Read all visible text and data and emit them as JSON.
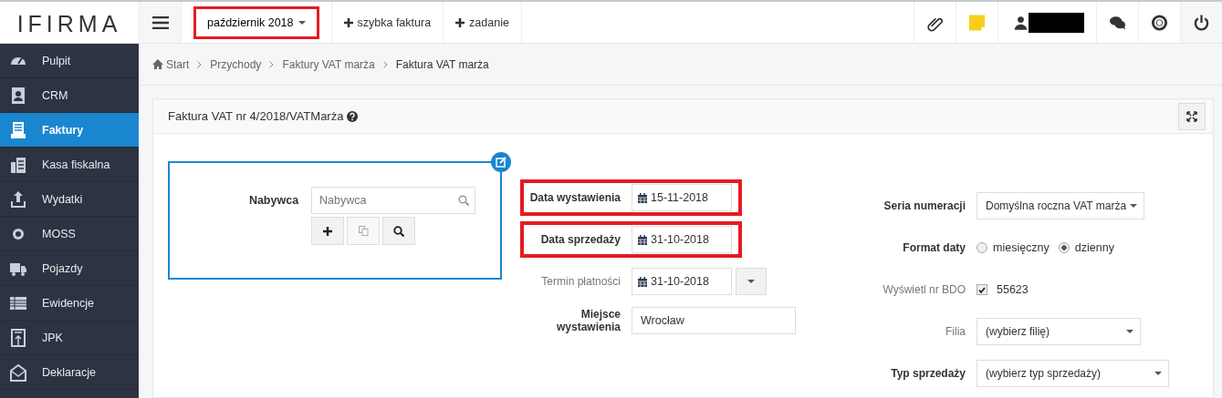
{
  "logo": {
    "text": "IFIRMA"
  },
  "topbar": {
    "period": {
      "label": "październik 2018",
      "highlighted": true
    },
    "actions": [
      {
        "label": "szybka faktura"
      },
      {
        "label": "zadanie"
      }
    ],
    "tools": [
      {
        "kind": "clip"
      },
      {
        "kind": "note"
      },
      {
        "kind": "user"
      },
      {
        "kind": "chat"
      },
      {
        "kind": "help"
      },
      {
        "kind": "power"
      }
    ]
  },
  "sidebar": {
    "items": [
      {
        "label": "Pulpit",
        "kind": "gauge",
        "selected": false
      },
      {
        "label": "CRM",
        "kind": "contact",
        "selected": false
      },
      {
        "label": "Faktury",
        "kind": "invoice",
        "selected": true
      },
      {
        "label": "Kasa fiskalna",
        "kind": "register",
        "selected": false
      },
      {
        "label": "Wydatki",
        "kind": "upload",
        "selected": false
      },
      {
        "label": "MOSS",
        "kind": "coin",
        "selected": false
      },
      {
        "label": "Pojazdy",
        "kind": "truck",
        "selected": false
      },
      {
        "label": "Ewidencje",
        "kind": "table",
        "selected": false
      },
      {
        "label": "JPK",
        "kind": "file",
        "selected": false
      },
      {
        "label": "Deklaracje",
        "kind": "envelope",
        "selected": false
      }
    ]
  },
  "breadcrumb": [
    "Start",
    "Przychody",
    "Faktury VAT marża",
    "Faktura VAT marża"
  ],
  "card": {
    "title": "Faktura VAT nr 4/2018/VATMarża",
    "buyer": {
      "label": "Nabywca",
      "placeholder": "Nabywca"
    },
    "dates": [
      {
        "kind": "date",
        "label": "Data wystawienia",
        "value": "15-11-2018",
        "muted": false,
        "highlighted": true
      },
      {
        "kind": "date",
        "label": "Data sprzedaży",
        "value": "31-10-2018",
        "muted": false,
        "highlighted": true
      },
      {
        "kind": "date-dropdown",
        "label": "Termin płatności",
        "value": "31-10-2018",
        "muted": true,
        "highlighted": false
      },
      {
        "kind": "text",
        "label": "Miejsce wystawienia",
        "value": "Wrocław",
        "muted": false,
        "highlighted": false
      }
    ],
    "settings": [
      {
        "kind": "select",
        "label": "Seria numeracji",
        "value": "Domyślna roczna VAT marża",
        "muted": false
      },
      {
        "kind": "radio",
        "label": "Format daty",
        "muted": false,
        "options": [
          {
            "label": "miesięczny",
            "selected": false
          },
          {
            "label": "dzienny",
            "selected": true
          }
        ]
      },
      {
        "kind": "checkbox",
        "label": "Wyświetl nr BDO",
        "value": "55623",
        "checked": true,
        "muted": true
      },
      {
        "kind": "select",
        "label": "Filia",
        "value": "(wybierz filię)",
        "muted": true
      },
      {
        "kind": "select-wide",
        "label": "Typ sprzedaży",
        "value": "(wybierz typ sprzedaży)",
        "muted": false
      }
    ]
  }
}
